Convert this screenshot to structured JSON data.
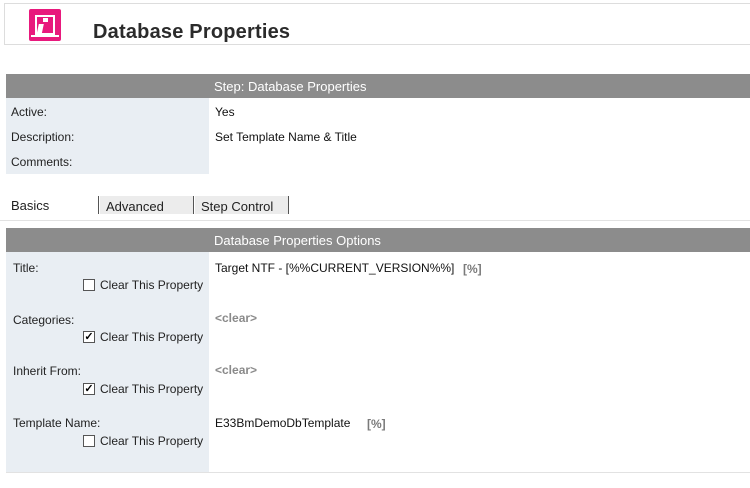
{
  "header": {
    "title": "Database Properties",
    "icon": "info-icon",
    "icon_color": "#e8197d"
  },
  "step_panel": {
    "header": "Step:  Database Properties",
    "rows": [
      {
        "label": "Active:",
        "value": "Yes"
      },
      {
        "label": "Description:",
        "value": "Set Template Name &  Title"
      },
      {
        "label": "Comments:",
        "value": ""
      }
    ]
  },
  "tabs": [
    {
      "label": "Basics",
      "selected": true
    },
    {
      "label": "Advanced",
      "selected": false
    },
    {
      "label": "Step Control",
      "selected": false
    }
  ],
  "options_panel": {
    "header": "Database Properties Options",
    "checkbox_label": "Clear This Property",
    "properties": [
      {
        "label": "Title:",
        "value": "Target NTF - [%%CURRENT_VERSION%%]",
        "token": "[%]",
        "clear_checked": false
      },
      {
        "label": "Categories:",
        "value": "",
        "token": "<clear>",
        "clear_checked": true
      },
      {
        "label": "Inherit From:",
        "value": "",
        "token": "<clear>",
        "clear_checked": true
      },
      {
        "label": "Template Name:",
        "value": "E33BmDemoDbTemplate",
        "token": "[%]",
        "clear_checked": false
      }
    ]
  },
  "colors": {
    "header_bar": "#8c8c8c",
    "label_column": "#e9eef3",
    "accent": "#e8197d"
  }
}
